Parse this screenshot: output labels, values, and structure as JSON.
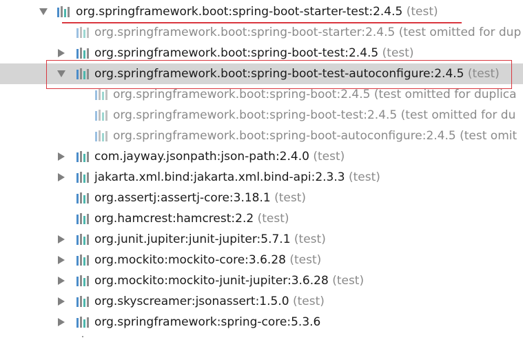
{
  "tree": {
    "rows": [
      {
        "name": "org.springframework.boot:spring-boot-starter-test:2.4.5",
        "scope": "(test)",
        "arrow": "down",
        "level": 0
      },
      {
        "name": "org.springframework.boot:spring-boot-starter:2.4.5",
        "scope": "(test omitted for dup",
        "arrow": "none",
        "level": 1,
        "omitted": true
      },
      {
        "name": "org.springframework.boot:spring-boot-test:2.4.5",
        "scope": "(test)",
        "arrow": "right",
        "level": 1
      },
      {
        "name": "org.springframework.boot:spring-boot-test-autoconfigure:2.4.5",
        "scope": "(test)",
        "arrow": "down",
        "level": 1,
        "selected": true
      },
      {
        "name": "org.springframework.boot:spring-boot:2.4.5",
        "scope": "(test omitted for duplica",
        "arrow": "none",
        "level": 2,
        "omitted": true
      },
      {
        "name": "org.springframework.boot:spring-boot-test:2.4.5",
        "scope": "(test omitted for du",
        "arrow": "none",
        "level": 2,
        "omitted": true
      },
      {
        "name": "org.springframework.boot:spring-boot-autoconfigure:2.4.5",
        "scope": "(test omit",
        "arrow": "none",
        "level": 2,
        "omitted": true
      },
      {
        "name": "com.jayway.jsonpath:json-path:2.4.0",
        "scope": "(test)",
        "arrow": "right",
        "level": 1
      },
      {
        "name": "jakarta.xml.bind:jakarta.xml.bind-api:2.3.3",
        "scope": "(test)",
        "arrow": "right",
        "level": 1
      },
      {
        "name": "org.assertj:assertj-core:3.18.1",
        "scope": "(test)",
        "arrow": "none",
        "level": 1
      },
      {
        "name": "org.hamcrest:hamcrest:2.2",
        "scope": "(test)",
        "arrow": "none",
        "level": 1
      },
      {
        "name": "org.junit.jupiter:junit-jupiter:5.7.1",
        "scope": "(test)",
        "arrow": "right",
        "level": 1
      },
      {
        "name": "org.mockito:mockito-core:3.6.28",
        "scope": "(test)",
        "arrow": "right",
        "level": 1
      },
      {
        "name": "org.mockito:mockito-junit-jupiter:3.6.28",
        "scope": "(test)",
        "arrow": "right",
        "level": 1
      },
      {
        "name": "org.skyscreamer:jsonassert:1.5.0",
        "scope": "(test)",
        "arrow": "right",
        "level": 1
      },
      {
        "name": "org.springframework:spring-core:5.3.6",
        "scope": "",
        "arrow": "right",
        "level": 1
      }
    ]
  },
  "colors": {
    "highlight": "#d9363e",
    "selected_row": "#d5d5d5",
    "omitted_text": "#8a8a8a"
  },
  "icons": {
    "library": "library-icon",
    "expand": "chevron-right-icon",
    "collapse": "chevron-down-icon"
  }
}
